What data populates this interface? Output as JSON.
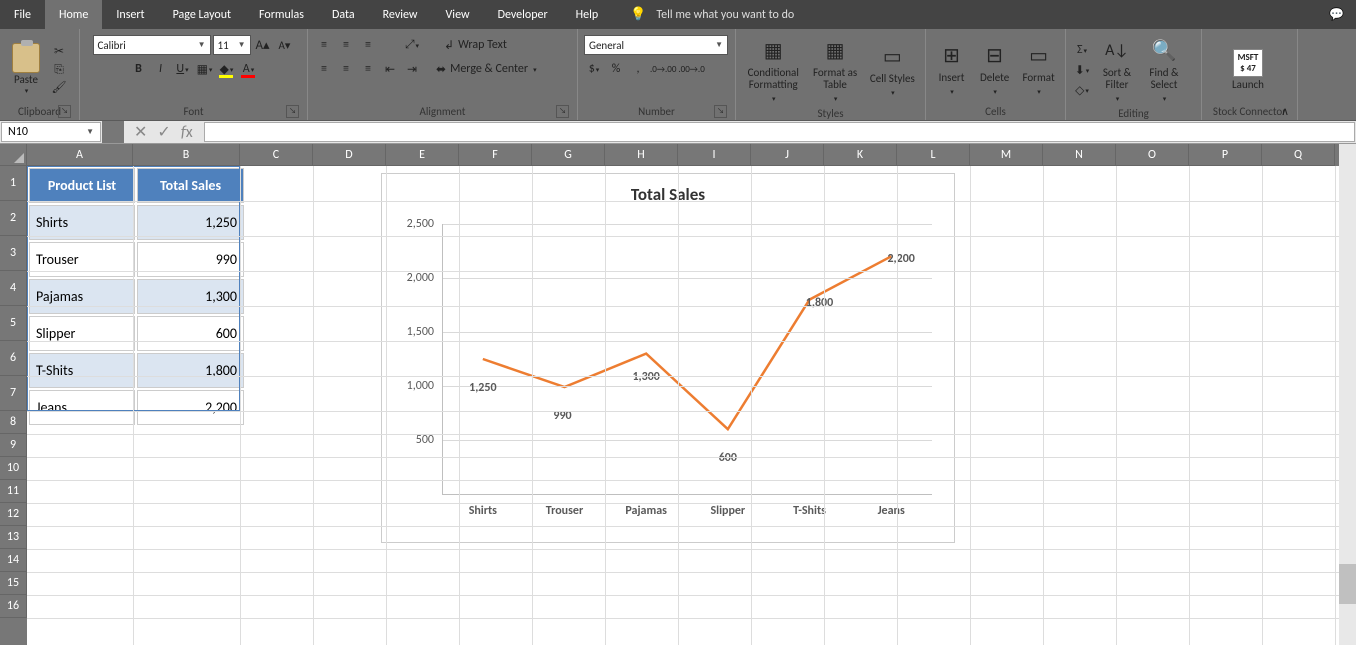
{
  "menu": {
    "items": [
      "File",
      "Home",
      "Insert",
      "Page Layout",
      "Formulas",
      "Data",
      "Review",
      "View",
      "Developer",
      "Help"
    ],
    "active": 1,
    "tell": "Tell me what you want to do"
  },
  "ribbon": {
    "clipboard": {
      "paste": "Paste",
      "label": "Clipboard"
    },
    "font": {
      "name": "Calibri",
      "size": "11",
      "label": "Font"
    },
    "alignment": {
      "wrap": "Wrap Text",
      "merge": "Merge & Center",
      "label": "Alignment"
    },
    "number": {
      "format": "General",
      "label": "Number"
    },
    "styles": {
      "cond": "Conditional Formatting",
      "fat": "Format as Table",
      "cell": "Cell Styles",
      "label": "Styles"
    },
    "cells": {
      "insert": "Insert",
      "delete": "Delete",
      "format": "Format",
      "label": "Cells"
    },
    "editing": {
      "sort": "Sort & Filter",
      "find": "Find & Select",
      "label": "Editing"
    },
    "stock": {
      "launch": "Launch",
      "t": "MSFT",
      "p": "$ 47",
      "label": "Stock Connector"
    }
  },
  "namebox": "N10",
  "columns": [
    "A",
    "B",
    "C",
    "D",
    "E",
    "F",
    "G",
    "H",
    "I",
    "J",
    "K",
    "L",
    "M",
    "N",
    "O",
    "P",
    "Q"
  ],
  "rows": [
    1,
    2,
    3,
    4,
    5,
    6,
    7,
    8,
    9,
    10,
    11,
    12,
    13,
    14,
    15,
    16
  ],
  "table": {
    "headers": [
      "Product List",
      "Total Sales"
    ],
    "rows": [
      {
        "p": "Shirts",
        "v": "1,250"
      },
      {
        "p": "Trouser",
        "v": "990"
      },
      {
        "p": "Pajamas",
        "v": "1,300"
      },
      {
        "p": "Slipper",
        "v": "600"
      },
      {
        "p": "T-Shits",
        "v": "1,800"
      },
      {
        "p": "Jeans",
        "v": "2,200"
      }
    ]
  },
  "chart_data": {
    "type": "line",
    "title": "Total Sales",
    "categories": [
      "Shirts",
      "Trouser",
      "Pajamas",
      "Slipper",
      "T-Shits",
      "Jeans"
    ],
    "values": [
      1250,
      990,
      1300,
      600,
      1800,
      2200
    ],
    "value_labels": [
      "1,250",
      "990",
      "1,300",
      "600",
      "1,800",
      "2,200"
    ],
    "ylim": [
      0,
      2500
    ],
    "yticks": [
      500,
      1000,
      1500,
      2000,
      2500
    ],
    "ytick_labels": [
      "500",
      "1,000",
      "1,500",
      "2,000",
      "2,500"
    ],
    "xlabel": "",
    "ylabel": ""
  }
}
